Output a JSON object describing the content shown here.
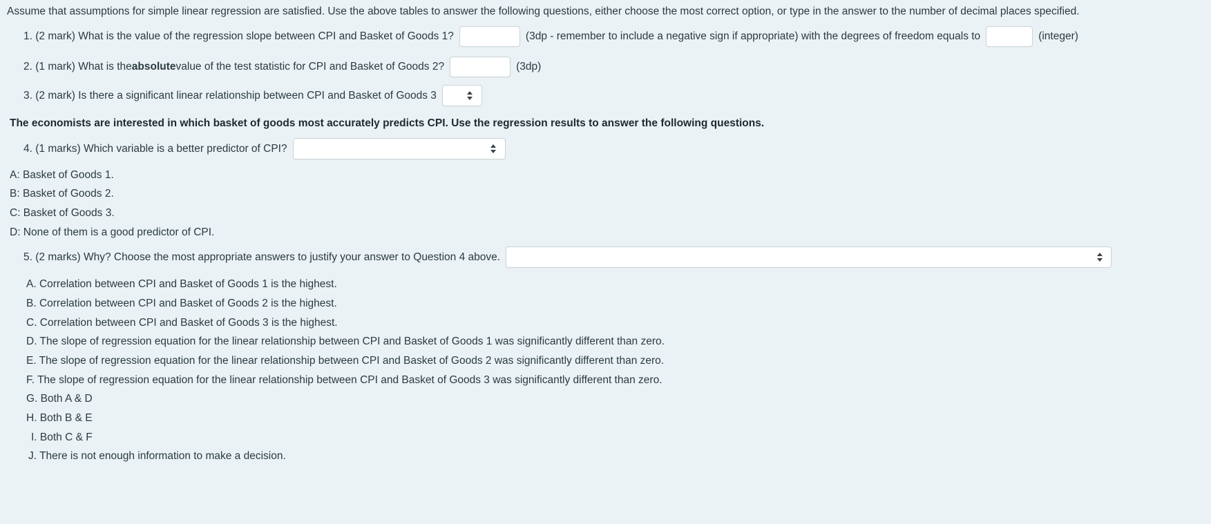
{
  "intro": "Assume that assumptions for simple linear regression are satisfied. Use the above tables to answer the following questions, either choose the most correct option, or type in the answer to the number of decimal places specified.",
  "questions": [
    {
      "number": "1.",
      "marks": "(2 mark)",
      "prompt_before": "1. (2 mark) What is the value of the regression slope between CPI and Basket of Goods 1?",
      "input1_value": "",
      "middle_text": "(3dp - remember to include a negative sign if appropriate) with the degrees of freedom equals to",
      "input2_value": "",
      "tail_text": "(integer)"
    },
    {
      "number": "2.",
      "prompt_part1": "2. (1 mark) What is the ",
      "bold_word": "absolute",
      "prompt_part2": " value of the test statistic for CPI and Basket of Goods 2?",
      "input_value": "",
      "tail_text": "(3dp)"
    },
    {
      "number": "3.",
      "prompt": "3. (2 mark) Is there a significant linear relationship between CPI and Basket of Goods 3",
      "select_value": ""
    },
    {
      "number": "4.",
      "prompt": "4. (1 marks) Which variable is a better predictor of CPI?",
      "select_value": ""
    },
    {
      "number": "5.",
      "prompt": "5. (2 marks) Why? Choose the most appropriate answers to justify your answer to Question 4 above.",
      "select_value": ""
    }
  ],
  "economists_note": "The economists are interested in which basket of goods most accurately predicts CPI. Use the regression results to answer the following questions.",
  "q4_options": [
    "A: Basket of Goods 1.",
    "B: Basket of Goods 2.",
    "C: Basket of Goods 3.",
    "D: None of them is a good predictor of CPI."
  ],
  "q5_options": [
    "A. Correlation between CPI and Basket of Goods 1 is the highest.",
    "B. Correlation between CPI and Basket of Goods 2 is the highest.",
    "C. Correlation between CPI and Basket of Goods 3 is the highest.",
    "D. The slope of regression equation for the linear relationship between CPI and Basket of Goods 1 was significantly different than zero.",
    "E. The slope of regression equation for the linear relationship between CPI and Basket of Goods 2 was significantly different than zero.",
    "F. The slope of regression equation for the linear relationship between CPI and Basket of Goods 3 was significantly different than zero.",
    "G. Both A & D",
    "H. Both B & E",
    "I. Both C & F",
    "J. There is not enough information to make a decision."
  ],
  "colors": {
    "background": "#eaf2f5",
    "text": "#2b3a42",
    "input_border": "#ccd2d6",
    "input_background": "#ffffff"
  }
}
